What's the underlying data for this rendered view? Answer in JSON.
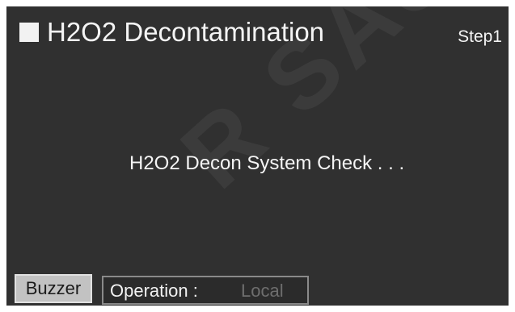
{
  "header": {
    "title": "H2O2 Decontamination",
    "step": "Step1"
  },
  "main": {
    "message": "H2O2 Decon System Check . . ."
  },
  "footer": {
    "buzzer_label": "Buzzer",
    "operation_label": "Operation :",
    "operation_value": "Local"
  },
  "watermark": "R SAS",
  "colors": {
    "screen_background": "#303030",
    "text": "#f2f2f2",
    "button_background": "#c2c2c2",
    "operation_value_text": "#6e6e6e"
  }
}
